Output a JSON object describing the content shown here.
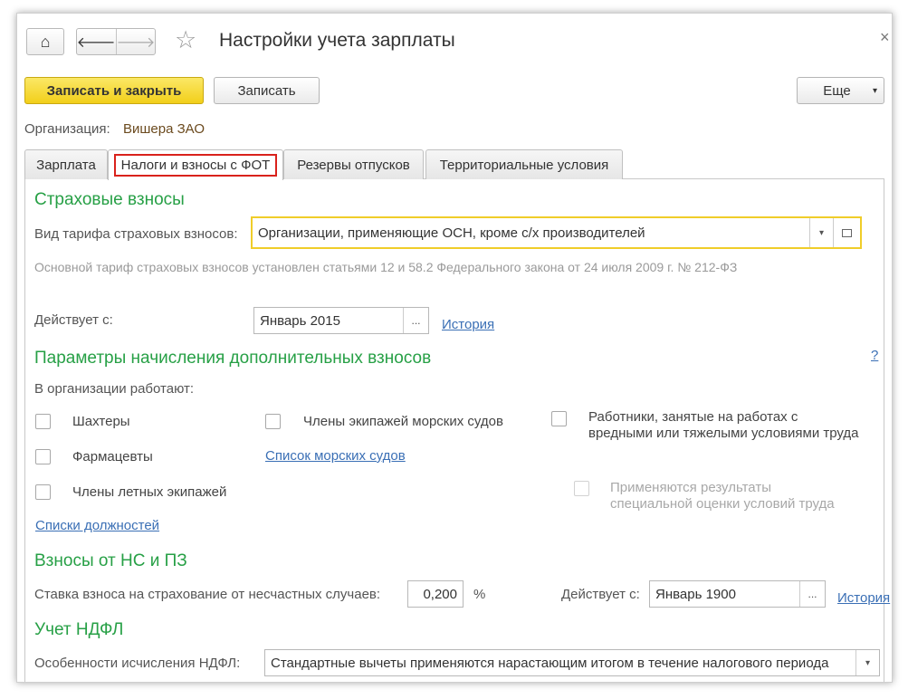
{
  "window": {
    "title": "Настройки учета зарплаты",
    "close_glyph": "×",
    "home_glyph": "⌂",
    "back_glyph": "🡐",
    "forward_glyph": "🡒",
    "star_glyph": "☆"
  },
  "toolbar": {
    "save_close_label": "Записать и закрыть",
    "save_label": "Записать",
    "more_label": "Еще",
    "more_arrow": "▾"
  },
  "organization": {
    "label": "Организация:",
    "value": "Вишера ЗАО"
  },
  "tabs": [
    {
      "label": "Зарплата",
      "active": false
    },
    {
      "label": "Налоги и взносы с ФОТ",
      "active": true
    },
    {
      "label": "Резервы отпусков",
      "active": false
    },
    {
      "label": "Территориальные условия",
      "active": false
    }
  ],
  "insurance": {
    "heading": "Страховые взносы",
    "tariff_label": "Вид тарифа страховых взносов:",
    "tariff_value": "Организации, применяющие ОСН, кроме с/х производителей",
    "tariff_hint": "Основной тариф страховых взносов установлен статьями 12 и 58.2 Федерального закона от 24 июля 2009 г. № 212-ФЗ",
    "effective_label": "Действует с:",
    "effective_value": "Январь 2015",
    "history_link": "История",
    "ellipsis": "..."
  },
  "additional": {
    "heading": "Параметры начисления дополнительных взносов",
    "help": "?",
    "subheading": "В организации работают:",
    "checkboxes": {
      "miners": "Шахтеры",
      "pharmacists": "Фармацевты",
      "flight_crew": "Члены летных экипажей",
      "sea_crew": "Члены экипажей морских судов",
      "harmful_line1": "Работники, занятые на работах с",
      "harmful_line2": "вредными или тяжелыми условиями труда",
      "special_line1": "Применяются результаты",
      "special_line2": "специальной оценки условий труда"
    },
    "ships_link": "Список морских судов",
    "positions_link": "Списки должностей"
  },
  "accident": {
    "heading": "Взносы от НС и ПЗ",
    "rate_label": "Ставка взноса на страхование от несчастных случаев:",
    "rate_value": "0,200",
    "percent": "%",
    "effective_label": "Действует с:",
    "effective_value": "Январь 1900",
    "history_link": "История"
  },
  "ndfl": {
    "heading": "Учет НДФЛ",
    "label": "Особенности исчисления НДФЛ:",
    "value": "Стандартные вычеты применяются нарастающим итогом в течение налогового периода"
  }
}
